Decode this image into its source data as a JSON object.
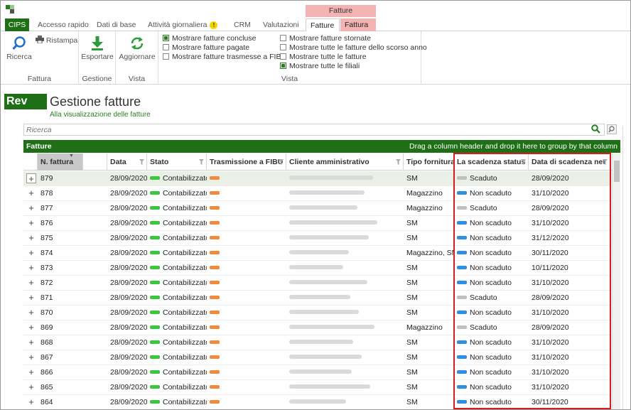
{
  "app": {
    "context_group": "Fatture",
    "tabs": [
      "CIPS",
      "Accesso rapido",
      "Dati di base",
      "Attività giornaliera",
      "CRM",
      "Valutazioni",
      "Fatture",
      "Fattura"
    ],
    "badge": "!"
  },
  "ribbon": {
    "fattura_group": {
      "label": "Fattura",
      "ricerca": "Ricerca",
      "ristampa": "Ristampa"
    },
    "gestione_group": {
      "label": "Gestione",
      "esportare": "Esportare"
    },
    "vista_small_group": {
      "label": "Vista",
      "aggiornare": "Aggiornare"
    },
    "vista_group": {
      "label": "Vista",
      "col1": [
        {
          "label": "Mostrare fatture concluse",
          "checked": true
        },
        {
          "label": "Mostrare fatture pagate",
          "checked": false
        },
        {
          "label": "Mostrare fatture trasmesse a FIBU",
          "checked": false
        }
      ],
      "col2": [
        {
          "label": "Mostrare fatture stornate",
          "checked": false
        },
        {
          "label": "Mostrare tutte le fatture dello scorso anno",
          "checked": false
        },
        {
          "label": "Mostrare tutte le fatture",
          "checked": false
        },
        {
          "label": "Mostrare tutte le filiali",
          "checked": true
        }
      ]
    }
  },
  "page": {
    "logo": "Rev",
    "title": "Gestione fatture",
    "subtitle": "Alla visualizzazione delle fatture"
  },
  "search": {
    "placeholder": "Ricerca"
  },
  "grid": {
    "title": "Fatture",
    "group_hint": "Drag a column header and drop it here to group by that column",
    "columns": [
      "N. fattura",
      "Data",
      "Stato",
      "Trasmissione a FIBU",
      "Cliente amministrativo",
      "Tipo fornitura",
      "La scadenza status",
      "Data di scadenza net"
    ],
    "rows": [
      {
        "num": "879",
        "data": "28/09/2020",
        "stato": "Contabilizzato",
        "tipo": "SM",
        "scad": "Scaduto",
        "data_scad": "28/09/2020"
      },
      {
        "num": "878",
        "data": "28/09/2020",
        "stato": "Contabilizzato",
        "tipo": "Magazzino",
        "scad": "Non scaduto",
        "data_scad": "31/10/2020"
      },
      {
        "num": "877",
        "data": "28/09/2020",
        "stato": "Contabilizzato",
        "tipo": "Magazzino",
        "scad": "Scaduto",
        "data_scad": "28/09/2020"
      },
      {
        "num": "876",
        "data": "28/09/2020",
        "stato": "Contabilizzato",
        "tipo": "SM",
        "scad": "Non scaduto",
        "data_scad": "31/10/2020"
      },
      {
        "num": "875",
        "data": "28/09/2020",
        "stato": "Contabilizzato",
        "tipo": "SM",
        "scad": "Non scaduto",
        "data_scad": "31/12/2020"
      },
      {
        "num": "874",
        "data": "28/09/2020",
        "stato": "Contabilizzato",
        "tipo": "Magazzino, SM",
        "scad": "Non scaduto",
        "data_scad": "30/11/2020"
      },
      {
        "num": "873",
        "data": "28/09/2020",
        "stato": "Contabilizzato",
        "tipo": "SM",
        "scad": "Non scaduto",
        "data_scad": "10/11/2020"
      },
      {
        "num": "872",
        "data": "28/09/2020",
        "stato": "Contabilizzato",
        "tipo": "SM",
        "scad": "Non scaduto",
        "data_scad": "31/10/2020"
      },
      {
        "num": "871",
        "data": "28/09/2020",
        "stato": "Contabilizzato",
        "tipo": "SM",
        "scad": "Scaduto",
        "data_scad": "28/09/2020"
      },
      {
        "num": "870",
        "data": "28/09/2020",
        "stato": "Contabilizzato",
        "tipo": "SM",
        "scad": "Non scaduto",
        "data_scad": "31/10/2020"
      },
      {
        "num": "869",
        "data": "28/09/2020",
        "stato": "Contabilizzato",
        "tipo": "Magazzino",
        "scad": "Scaduto",
        "data_scad": "28/09/2020"
      },
      {
        "num": "868",
        "data": "28/09/2020",
        "stato": "Contabilizzato",
        "tipo": "SM",
        "scad": "Non scaduto",
        "data_scad": "31/10/2020"
      },
      {
        "num": "867",
        "data": "28/09/2020",
        "stato": "Contabilizzato",
        "tipo": "SM",
        "scad": "Non scaduto",
        "data_scad": "31/10/2020"
      },
      {
        "num": "866",
        "data": "28/09/2020",
        "stato": "Contabilizzato",
        "tipo": "SM",
        "scad": "Non scaduto",
        "data_scad": "31/10/2020"
      },
      {
        "num": "865",
        "data": "28/09/2020",
        "stato": "Contabilizzato",
        "tipo": "SM",
        "scad": "Non scaduto",
        "data_scad": "31/10/2020"
      },
      {
        "num": "864",
        "data": "28/09/2020",
        "stato": "Contabilizzato",
        "tipo": "SM",
        "scad": "Non scaduto",
        "data_scad": "30/11/2020"
      }
    ]
  },
  "colors": {
    "brand_green": "#1f6f16",
    "contabilizzato": "#3cc63c",
    "fibu": "#f08a3c",
    "scaduto": "#c0c0c0",
    "non_scaduto": "#2f8fe0",
    "highlight": "#d81c1c"
  }
}
